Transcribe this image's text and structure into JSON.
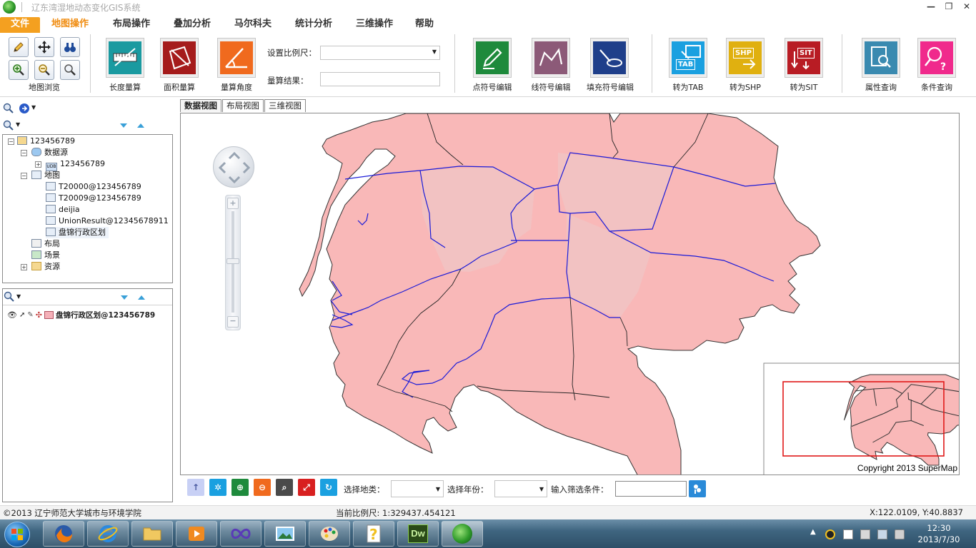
{
  "window": {
    "title": "辽东湾湿地动态变化GIS系统",
    "minimize": "—",
    "restore": "❐",
    "close": "✕"
  },
  "menu": {
    "tabs": [
      {
        "label": "文件"
      },
      {
        "label": "地图操作"
      },
      {
        "label": "布局操作"
      },
      {
        "label": "叠加分析"
      },
      {
        "label": "马尔科夫"
      },
      {
        "label": "统计分析"
      },
      {
        "label": "三维操作"
      },
      {
        "label": "帮助"
      }
    ]
  },
  "ribbon": {
    "browse_group_label": "地图浏览",
    "length_label": "长度量算",
    "area_label": "面积量算",
    "angle_label": "量算角度",
    "scale_label": "设置比例尺：",
    "scale_value": "",
    "result_label": "量算结果：",
    "result_value": "",
    "point_label": "点符号编辑",
    "line_label": "线符号编辑",
    "fill_label": "填充符号编辑",
    "totab_label": "转为TAB",
    "toshp_label": "转为SHP",
    "tosit_label": "转为SIT",
    "attr_label": "属性查询",
    "cond_label": "条件查询",
    "tab_tile_text": "TAB",
    "shp_tile_text": "SHP",
    "sit_tile_text": "SIT",
    "colors": {
      "length": "#1a9aa0",
      "area": "#a51c1c",
      "angle": "#f06a1e",
      "point": "#1e8a3c",
      "line": "#8c5a78",
      "fill": "#1f3f8a",
      "totab": "#1aa0e0",
      "toshp": "#e0b010",
      "tosit": "#b81c24",
      "attr": "#3a8ab0",
      "cond": "#f02a8c"
    }
  },
  "workspace_tree": {
    "items": [
      {
        "label": "123456789",
        "icon": "workspace-icon"
      },
      {
        "label": "数据源",
        "icon": "datasource-icon"
      },
      {
        "label": "123456789",
        "icon": "udb-icon"
      },
      {
        "label": "地图",
        "icon": "map-folder-icon"
      },
      {
        "label": "T20000@123456789",
        "icon": "map-icon"
      },
      {
        "label": "T20009@123456789",
        "icon": "map-icon"
      },
      {
        "label": "deijia",
        "icon": "map-icon"
      },
      {
        "label": "UnionResult@12345678911",
        "icon": "map-icon"
      },
      {
        "label": "盘锦行政区划",
        "icon": "map-icon"
      },
      {
        "label": "布局",
        "icon": "layout-icon"
      },
      {
        "label": "场景",
        "icon": "scene-icon"
      },
      {
        "label": "资源",
        "icon": "resource-folder-icon"
      }
    ],
    "udb_badge": "UDB"
  },
  "layer_panel": {
    "layers": [
      {
        "label": "盘锦行政区划@123456789"
      }
    ]
  },
  "view_tabs": [
    {
      "label": "数据视图"
    },
    {
      "label": "布局视图"
    },
    {
      "label": "三维视图"
    }
  ],
  "map": {
    "copyright": "Copyright 2013 SuperMap",
    "fill_color": "#f9b8b8",
    "district_fill": "#f2c2c2",
    "boundary_color": "#1a1ad8",
    "extent_color": "#e01818"
  },
  "bottom_toolbar": {
    "landtype_label": "选择地类：",
    "landtype_value": "",
    "year_label": "选择年份：",
    "year_value": "",
    "filter_label": "输入筛选条件：",
    "filter_value": ""
  },
  "status": {
    "org": "©2013 辽宁师范大学城市与环境学院",
    "scale": "当前比例尺:  1:329437.454121",
    "coords": "X:122.0109,  Y:40.8837"
  },
  "taskbar": {
    "time": "12:30",
    "date": "2013/7/30",
    "dw_label": "Dw"
  }
}
